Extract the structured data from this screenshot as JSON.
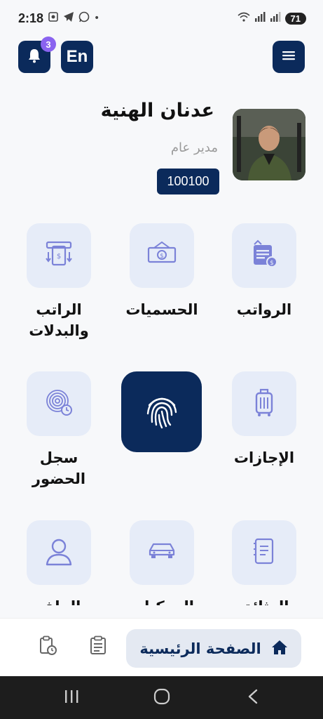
{
  "status_bar": {
    "time": "2:18",
    "battery": "71"
  },
  "header": {
    "notification_count": "3",
    "language_label": "En"
  },
  "profile": {
    "name": "عدنان الهنية",
    "title": "مدير عام",
    "employee_id": "100100"
  },
  "tiles": [
    {
      "label": "الرواتب",
      "icon": "salary-doc-icon"
    },
    {
      "label": "الحسميات",
      "icon": "cash-icon"
    },
    {
      "label": "الراتب والبدلات",
      "icon": "atm-cash-icon"
    },
    {
      "label": "الإجازات",
      "icon": "luggage-icon"
    },
    {
      "label": "",
      "icon": "fingerprint-icon"
    },
    {
      "label": "سجل الحضور",
      "icon": "fingerprint-clock-icon"
    },
    {
      "label": "الوثائق",
      "icon": "document-icon"
    },
    {
      "label": "المركبات",
      "icon": "car-icon"
    },
    {
      "label": "الملف",
      "icon": "user-icon"
    }
  ],
  "bottom_nav": {
    "home_label": "الصفحة الرئيسية"
  },
  "colors": {
    "primary": "#0b2a5b",
    "tile_bg": "#e6ecf8",
    "icon_tint": "#7b82d8",
    "badge": "#8a63f0"
  }
}
